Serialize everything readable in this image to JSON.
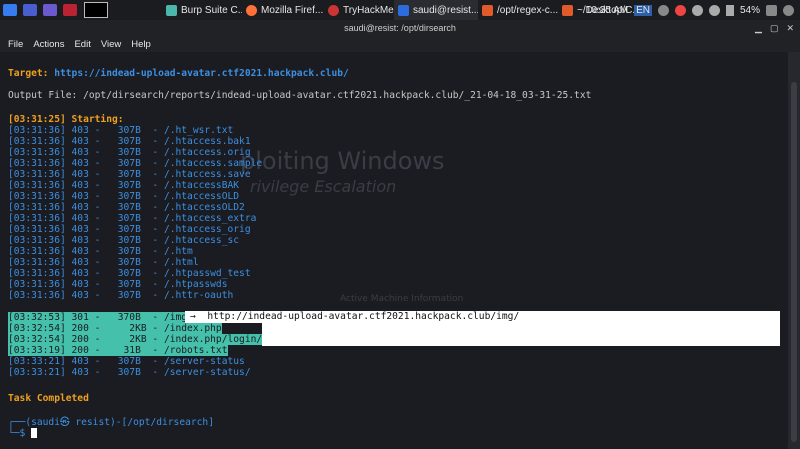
{
  "taskbar": {
    "tasks": [
      {
        "label": "Burp Suite C...",
        "color": "#4db6ac"
      },
      {
        "label": "Mozilla Firef...",
        "color": "#ff7139"
      },
      {
        "label": "TryHackMe |",
        "color": "#c33"
      },
      {
        "label": "saudi@resist...",
        "color": "#2d6cdf"
      },
      {
        "label": "/opt/regex-c...",
        "color": "#e05a2b"
      },
      {
        "label": "~/Desktop/C...",
        "color": "#e05a2b"
      }
    ],
    "time": "10:35 AM",
    "lang": "EN",
    "battery": "54%"
  },
  "window": {
    "title": "saudi@resist: /opt/dirsearch",
    "menu": [
      "File",
      "Actions",
      "Edit",
      "View",
      "Help"
    ]
  },
  "terminal": {
    "target_label": "Target: ",
    "target_url": "https://indead-upload-avatar.ctf2021.hackpack.club/",
    "output_file": "Output File: /opt/dirsearch/reports/indead-upload-avatar.ctf2021.hackpack.club/_21-04-18_03-31-25.txt",
    "starting": "[03:31:25] Starting:",
    "lines": [
      "[03:31:36] 403 -   307B  - /.ht_wsr.txt",
      "[03:31:36] 403 -   307B  - /.htaccess.bak1",
      "[03:31:36] 403 -   307B  - /.htaccess.orig",
      "[03:31:36] 403 -   307B  - /.htaccess.sample",
      "[03:31:36] 403 -   307B  - /.htaccess.save",
      "[03:31:36] 403 -   307B  - /.htaccessBAK",
      "[03:31:36] 403 -   307B  - /.htaccessOLD",
      "[03:31:36] 403 -   307B  - /.htaccessOLD2",
      "[03:31:36] 403 -   307B  - /.htaccess_extra",
      "[03:31:36] 403 -   307B  - /.htaccess_orig",
      "[03:31:36] 403 -   307B  - /.htaccess_sc",
      "[03:31:36] 403 -   307B  - /.htm",
      "[03:31:36] 403 -   307B  - /.html",
      "[03:31:36] 403 -   307B  - /.htpasswd_test",
      "[03:31:36] 403 -   307B  - /.htpasswds",
      "[03:31:36] 403 -   307B  - /.httr-oauth",
      "[03:32:53] 301 -   370B  - /img",
      "[03:32:54] 200 -     2KB - /index.php",
      "[03:32:54] 200 -     2KB - /index.php/login/",
      "[03:33:19] 200 -    31B  - /robots.txt",
      "[03:33:21] 403 -   307B  - /server-status",
      "[03:33:21] 403 -   307B  - /server-status/"
    ],
    "redirect": "→  http://indead-upload-avatar.ctf2021.hackpack.club/img/",
    "task_completed": "Task Completed",
    "prompt_top": "┌──(saudi㉿ resist)-[/opt/dirsearch]",
    "prompt_bottom": "└─$ "
  },
  "ghost": {
    "title": "ploiting Windows",
    "subtitle": "rivilege Escalation",
    "machine": "Active Machine Information"
  }
}
